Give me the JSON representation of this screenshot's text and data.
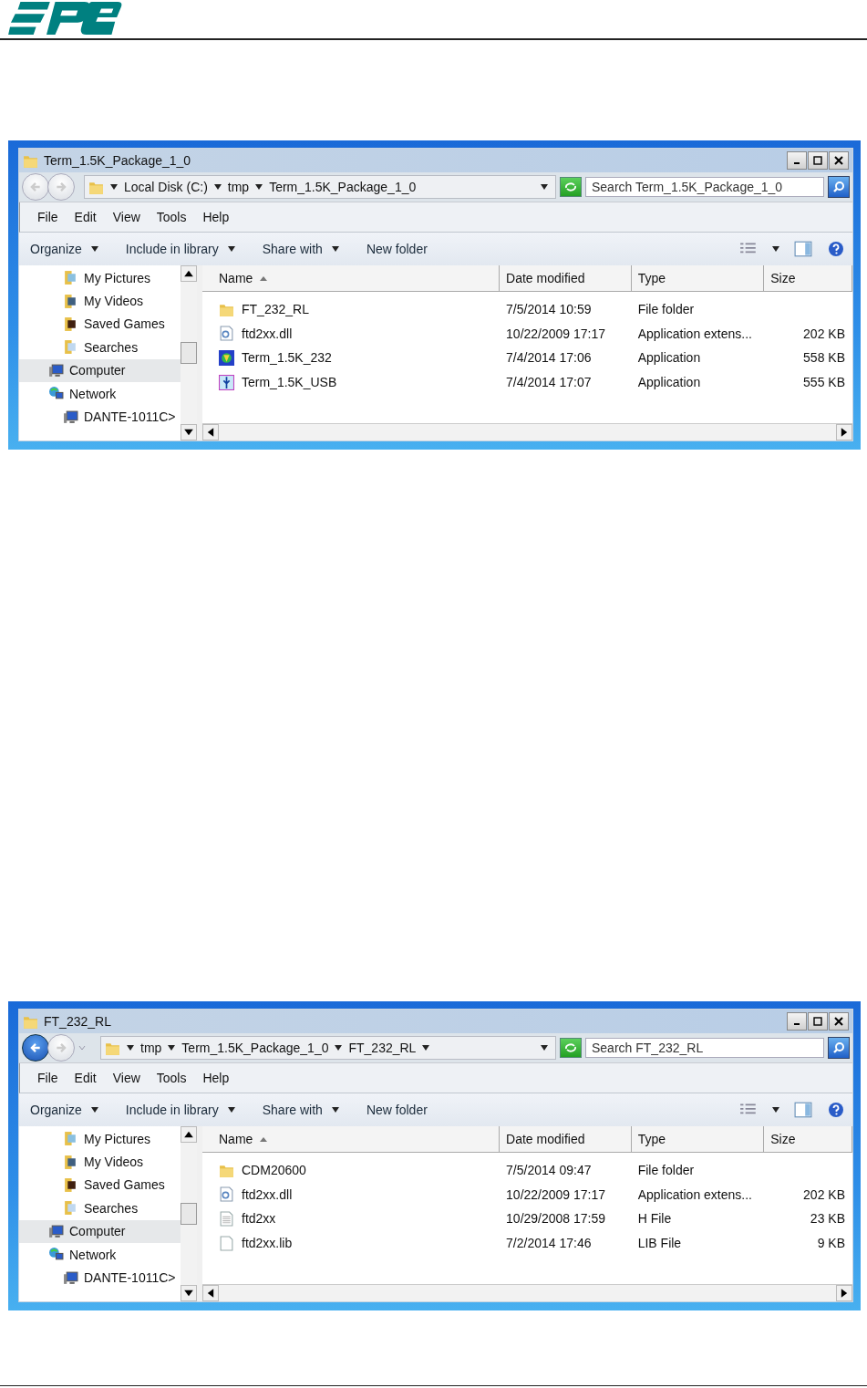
{
  "windows": [
    {
      "title": "Term_1.5K_Package_1_0",
      "back_enabled": false,
      "history_dropdown": false,
      "breadcrumbs": [
        "Local Disk (C:)",
        "tmp",
        "Term_1.5K_Package_1_0"
      ],
      "trailing_arrow": false,
      "search": {
        "placeholder": "Search Term_1.5K_Package_1_0"
      },
      "menu": [
        "File",
        "Edit",
        "View",
        "Tools",
        "Help"
      ],
      "toolbar": [
        {
          "label": "Organize",
          "dropdown": true
        },
        {
          "label": "Include in library",
          "dropdown": true
        },
        {
          "label": "Share with",
          "dropdown": true
        },
        {
          "label": "New folder",
          "dropdown": false
        }
      ],
      "nav_partial": [
        {
          "label": "My Pictures",
          "kind": "pictures",
          "selected": false
        },
        {
          "label": "My Videos",
          "kind": "videos",
          "selected": false
        },
        {
          "label": "Saved Games",
          "kind": "games",
          "selected": false
        },
        {
          "label": "Searches",
          "kind": "searches",
          "selected": false
        }
      ],
      "nav_tree": [
        {
          "label": "Computer",
          "kind": "computer",
          "selected": true
        },
        {
          "label": "Network",
          "kind": "network",
          "selected": false,
          "children": [
            {
              "label": "DANTE-1011C>",
              "kind": "computer",
              "selected": false
            }
          ]
        }
      ],
      "columns": [
        "Name",
        "Date modified",
        "Type",
        "Size"
      ],
      "rows": [
        {
          "name": "FT_232_RL",
          "kind": "folder",
          "date": "7/5/2014 10:59",
          "type": "File folder",
          "size": ""
        },
        {
          "name": "ftd2xx.dll",
          "kind": "dll",
          "date": "10/22/2009 17:17",
          "type": "Application extens...",
          "size": "202 KB"
        },
        {
          "name": "Term_1.5K_232",
          "kind": "app-globe",
          "date": "7/4/2014 17:06",
          "type": "Application",
          "size": "558 KB"
        },
        {
          "name": "Term_1.5K_USB",
          "kind": "app-usb",
          "date": "7/4/2014 17:07",
          "type": "Application",
          "size": "555 KB"
        }
      ]
    },
    {
      "title": "FT_232_RL",
      "back_enabled": true,
      "history_dropdown": true,
      "breadcrumbs": [
        "tmp",
        "Term_1.5K_Package_1_0",
        "FT_232_RL"
      ],
      "trailing_arrow": true,
      "search": {
        "placeholder": "Search FT_232_RL"
      },
      "menu": [
        "File",
        "Edit",
        "View",
        "Tools",
        "Help"
      ],
      "toolbar": [
        {
          "label": "Organize",
          "dropdown": true
        },
        {
          "label": "Include in library",
          "dropdown": true
        },
        {
          "label": "Share with",
          "dropdown": true
        },
        {
          "label": "New folder",
          "dropdown": false
        }
      ],
      "nav_partial": [
        {
          "label": "My Pictures",
          "kind": "pictures",
          "selected": false
        },
        {
          "label": "My Videos",
          "kind": "videos",
          "selected": false
        },
        {
          "label": "Saved Games",
          "kind": "games",
          "selected": false
        },
        {
          "label": "Searches",
          "kind": "searches",
          "selected": false
        }
      ],
      "nav_tree": [
        {
          "label": "Computer",
          "kind": "computer",
          "selected": true
        },
        {
          "label": "Network",
          "kind": "network",
          "selected": false,
          "children": [
            {
              "label": "DANTE-1011C>",
              "kind": "computer",
              "selected": false
            }
          ]
        }
      ],
      "columns": [
        "Name",
        "Date modified",
        "Type",
        "Size"
      ],
      "rows": [
        {
          "name": "CDM20600",
          "kind": "folder",
          "date": "7/5/2014 09:47",
          "type": "File folder",
          "size": ""
        },
        {
          "name": "ftd2xx.dll",
          "kind": "dll",
          "date": "10/22/2009 17:17",
          "type": "Application extens...",
          "size": "202 KB"
        },
        {
          "name": "ftd2xx",
          "kind": "text",
          "date": "10/29/2008 17:59",
          "type": "H File",
          "size": "23 KB"
        },
        {
          "name": "ftd2xx.lib",
          "kind": "blank",
          "date": "7/2/2014 17:46",
          "type": "LIB File",
          "size": "9 KB"
        }
      ]
    }
  ]
}
